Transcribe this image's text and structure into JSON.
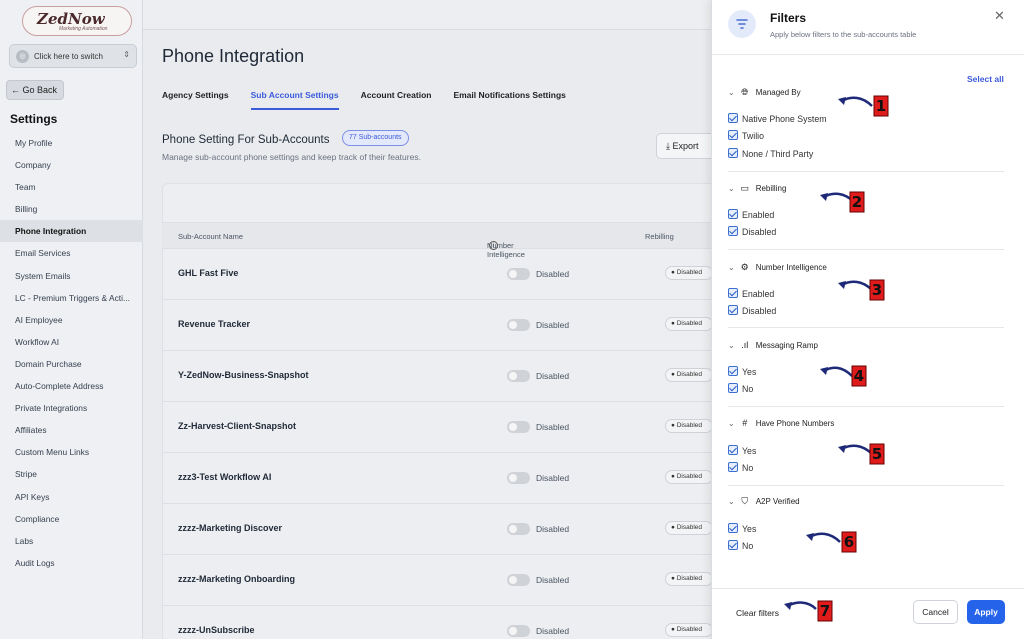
{
  "sidebar": {
    "logo": {
      "brand": "ZedNow",
      "tagline": "Marketing Automation"
    },
    "switch_label": "Click here to switch",
    "go_back": "← Go Back",
    "heading": "Settings",
    "items": [
      {
        "label": "My Profile"
      },
      {
        "label": "Company"
      },
      {
        "label": "Team"
      },
      {
        "label": "Billing"
      },
      {
        "label": "Phone Integration",
        "active": true
      },
      {
        "label": "Email Services"
      },
      {
        "label": "System Emails"
      },
      {
        "label": "LC - Premium Triggers & Acti..."
      },
      {
        "label": "AI Employee"
      },
      {
        "label": "Workflow AI"
      },
      {
        "label": "Domain Purchase"
      },
      {
        "label": "Auto-Complete Address"
      },
      {
        "label": "Private Integrations"
      },
      {
        "label": "Affiliates"
      },
      {
        "label": "Custom Menu Links"
      },
      {
        "label": "Stripe"
      },
      {
        "label": "API Keys"
      },
      {
        "label": "Compliance"
      },
      {
        "label": "Labs"
      },
      {
        "label": "Audit Logs"
      }
    ]
  },
  "main": {
    "title": "Phone Integration",
    "tabs": [
      {
        "label": "Agency Settings"
      },
      {
        "label": "Sub Account Settings",
        "active": true
      },
      {
        "label": "Account Creation"
      },
      {
        "label": "Email Notifications Settings"
      }
    ],
    "section_title": "Phone Setting For Sub-Accounts",
    "count_badge": "77 Sub-accounts",
    "section_subtitle": "Manage sub-account phone settings and keep track of their features.",
    "export_label": "Export",
    "columns": {
      "name": "Sub-Account Name",
      "number_intelligence": "Number Intelligence",
      "rebilling": "Rebilling"
    },
    "rows": [
      {
        "name": "GHL Fast Five",
        "ni": "Disabled",
        "rebilling": "Disabled"
      },
      {
        "name": "Revenue Tracker",
        "ni": "Disabled",
        "rebilling": "Disabled"
      },
      {
        "name": "Y-ZedNow-Business-Snapshot",
        "ni": "Disabled",
        "rebilling": "Disabled"
      },
      {
        "name": "Zz-Harvest-Client-Snapshot",
        "ni": "Disabled",
        "rebilling": "Disabled"
      },
      {
        "name": "zzz3-Test Workflow AI",
        "ni": "Disabled",
        "rebilling": "Disabled"
      },
      {
        "name": "zzzz-Marketing Discover",
        "ni": "Disabled",
        "rebilling": "Disabled"
      },
      {
        "name": "zzzz-Marketing Onboarding",
        "ni": "Disabled",
        "rebilling": "Disabled"
      },
      {
        "name": "zzzz-UnSubscribe",
        "ni": "Disabled",
        "rebilling": "Disabled"
      }
    ]
  },
  "filters": {
    "title": "Filters",
    "subtitle": "Apply below filters to the sub-accounts table",
    "select_all": "Select all",
    "groups": [
      {
        "label": "Managed By",
        "icon": "globe-icon",
        "options": [
          "Native Phone System",
          "Twilio",
          "None / Third Party"
        ]
      },
      {
        "label": "Rebilling",
        "icon": "wallet-icon",
        "options": [
          "Enabled",
          "Disabled"
        ]
      },
      {
        "label": "Number Intelligence",
        "icon": "chip-icon",
        "options": [
          "Enabled",
          "Disabled"
        ]
      },
      {
        "label": "Messaging Ramp",
        "icon": "signal-icon",
        "options": [
          "Yes",
          "No"
        ]
      },
      {
        "label": "Have Phone Numbers",
        "icon": "hash-icon",
        "options": [
          "Yes",
          "No"
        ]
      },
      {
        "label": "A2P Verified",
        "icon": "shield-check-icon",
        "options": [
          "Yes",
          "No"
        ]
      }
    ],
    "clear_label": "Clear filters",
    "cancel_label": "Cancel",
    "apply_label": "Apply"
  },
  "annotations": [
    "1",
    "2",
    "3",
    "4",
    "5",
    "6",
    "7"
  ],
  "colors": {
    "accent": "#2563eb",
    "callout_fill": "#e01b1b",
    "arrow": "#1e2a78"
  }
}
